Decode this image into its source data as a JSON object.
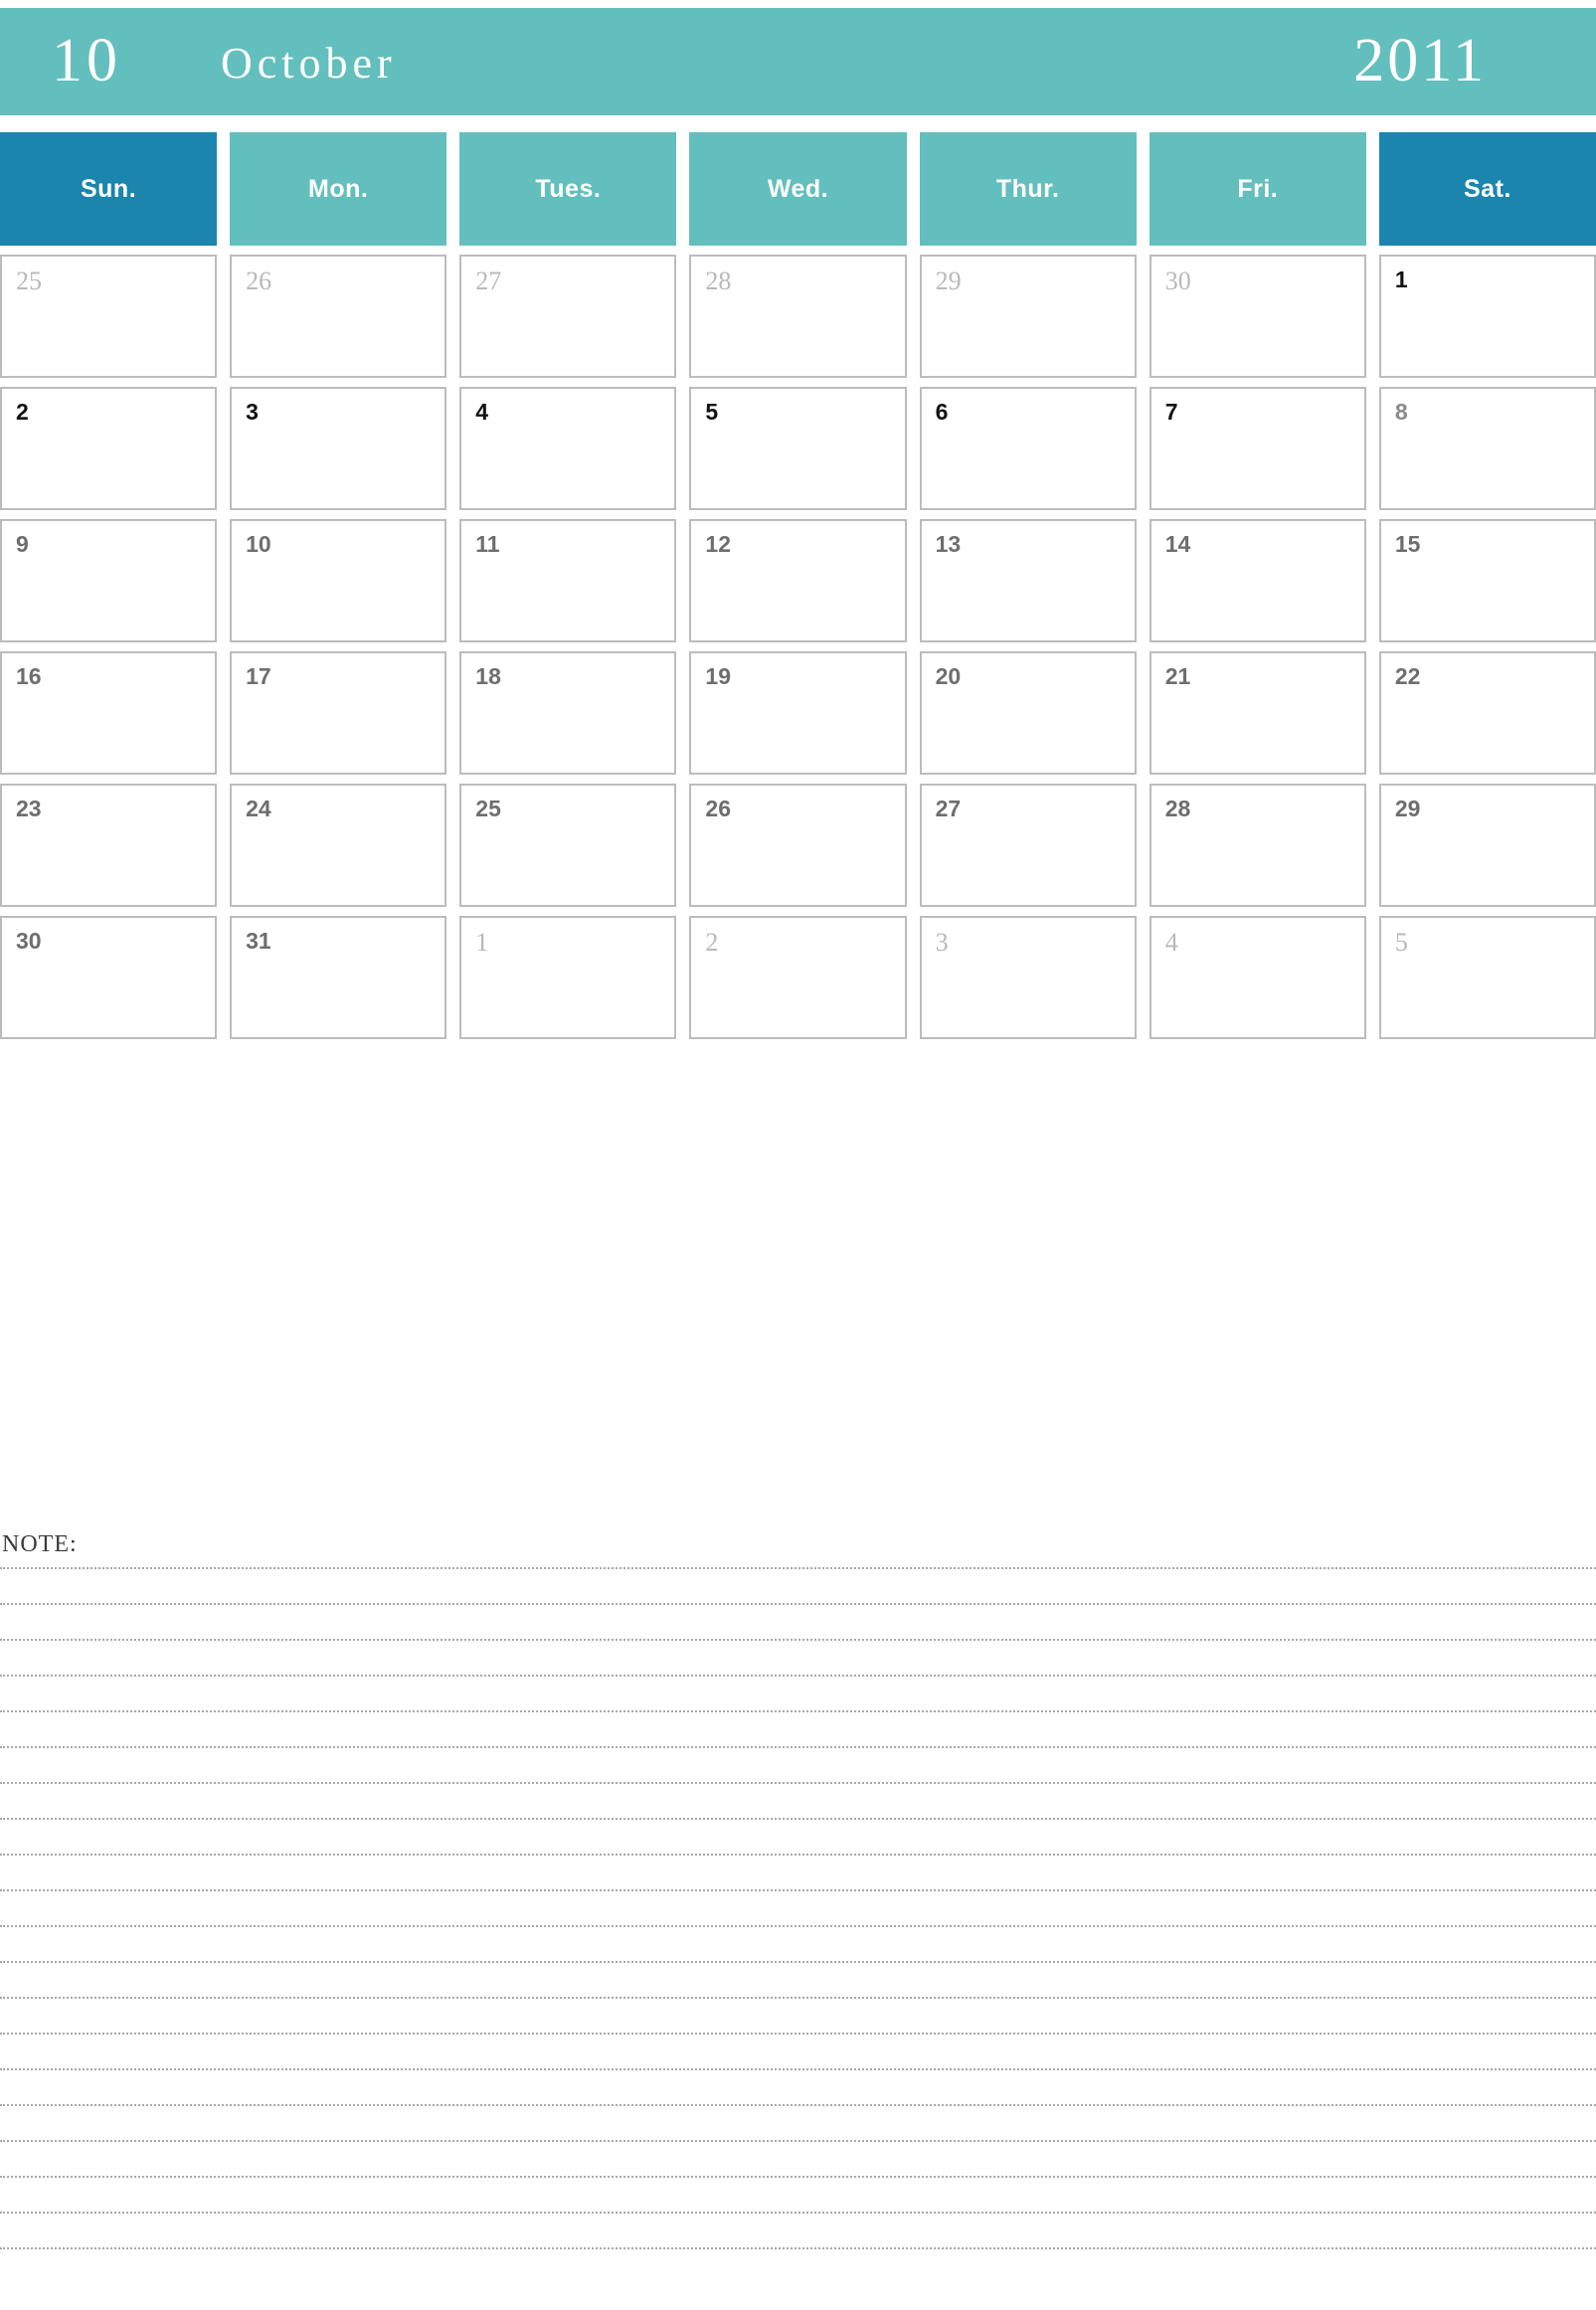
{
  "header": {
    "month_number": "10",
    "month_name": "October",
    "year": "2011",
    "band_color": "#63bfbd",
    "text_color": "#ffffff"
  },
  "weekdays": {
    "weekend_color": "#1b85ad",
    "weekday_color": "#63bfbd",
    "items": [
      {
        "label": "Sun.",
        "weekend": true
      },
      {
        "label": "Mon.",
        "weekend": false
      },
      {
        "label": "Tues.",
        "weekend": false
      },
      {
        "label": "Wed.",
        "weekend": false
      },
      {
        "label": "Thur.",
        "weekend": false
      },
      {
        "label": "Fri.",
        "weekend": false
      },
      {
        "label": "Sat.",
        "weekend": true
      }
    ]
  },
  "calendar": {
    "cell_border_color": "#bcbcbc",
    "weeks": [
      {
        "days": [
          {
            "num": "25",
            "style": "other-month"
          },
          {
            "num": "26",
            "style": "other-month"
          },
          {
            "num": "27",
            "style": "other-month"
          },
          {
            "num": "28",
            "style": "other-month"
          },
          {
            "num": "29",
            "style": "other-month"
          },
          {
            "num": "30",
            "style": "other-month"
          },
          {
            "num": "1",
            "style": "first-weeks"
          }
        ]
      },
      {
        "days": [
          {
            "num": "2",
            "style": "first-weeks"
          },
          {
            "num": "3",
            "style": "first-weeks"
          },
          {
            "num": "4",
            "style": "first-weeks"
          },
          {
            "num": "5",
            "style": "first-weeks"
          },
          {
            "num": "6",
            "style": "first-weeks"
          },
          {
            "num": "7",
            "style": "first-weeks"
          },
          {
            "num": "8",
            "style": "muted-dark"
          }
        ]
      },
      {
        "days": [
          {
            "num": "9",
            "style": "current"
          },
          {
            "num": "10",
            "style": "current"
          },
          {
            "num": "11",
            "style": "current"
          },
          {
            "num": "12",
            "style": "current"
          },
          {
            "num": "13",
            "style": "current"
          },
          {
            "num": "14",
            "style": "current"
          },
          {
            "num": "15",
            "style": "current"
          }
        ]
      },
      {
        "days": [
          {
            "num": "16",
            "style": "current"
          },
          {
            "num": "17",
            "style": "current"
          },
          {
            "num": "18",
            "style": "current"
          },
          {
            "num": "19",
            "style": "current"
          },
          {
            "num": "20",
            "style": "current"
          },
          {
            "num": "21",
            "style": "current"
          },
          {
            "num": "22",
            "style": "current"
          }
        ]
      },
      {
        "days": [
          {
            "num": "23",
            "style": "current"
          },
          {
            "num": "24",
            "style": "current"
          },
          {
            "num": "25",
            "style": "current"
          },
          {
            "num": "26",
            "style": "current"
          },
          {
            "num": "27",
            "style": "current"
          },
          {
            "num": "28",
            "style": "current"
          },
          {
            "num": "29",
            "style": "current"
          }
        ]
      },
      {
        "days": [
          {
            "num": "30",
            "style": "current"
          },
          {
            "num": "31",
            "style": "current"
          },
          {
            "num": "1",
            "style": "other-month"
          },
          {
            "num": "2",
            "style": "other-month"
          },
          {
            "num": "3",
            "style": "other-month"
          },
          {
            "num": "4",
            "style": "other-month"
          },
          {
            "num": "5",
            "style": "other-month"
          }
        ]
      }
    ]
  },
  "note": {
    "label": "NOTE:",
    "line_count": 20
  }
}
